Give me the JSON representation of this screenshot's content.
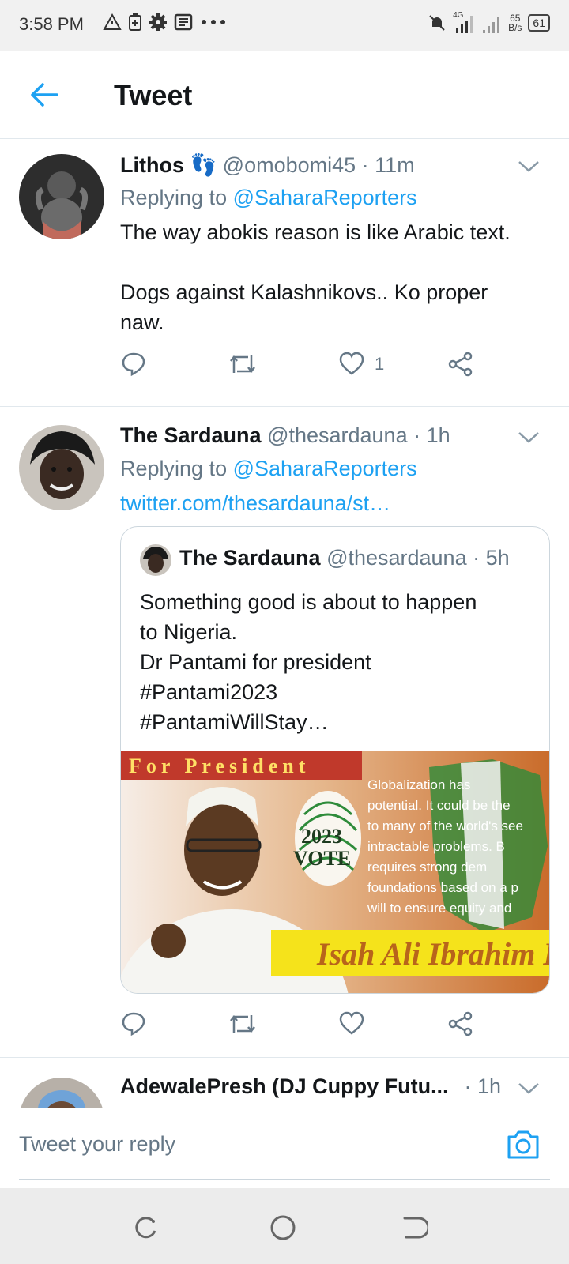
{
  "status_bar": {
    "time": "3:58 PM",
    "network": "4G",
    "speed_value": "65",
    "speed_unit": "B/s",
    "battery": "61"
  },
  "header": {
    "title": "Tweet"
  },
  "tweets": [
    {
      "name": "Lithos",
      "emoji": "👣",
      "handle": "@omobomi45",
      "time": "· 11m",
      "replying_prefix": "Replying to",
      "replying_to": "@SaharaReporters",
      "body_lines": [
        "The way abokis reason is like Arabic text.",
        "",
        "Dogs against Kalashnikovs.. Ko proper",
        "naw."
      ],
      "like_count": "1"
    },
    {
      "name": "The Sardauna",
      "handle": "@thesardauna",
      "time": "· 1h",
      "replying_prefix": "Replying to",
      "replying_to": "@SaharaReporters",
      "link": "twitter.com/thesardauna/st…",
      "quote": {
        "name": "The Sardauna",
        "handle": "@thesardauna",
        "time": "· 5h",
        "body_lines": [
          "Something good is about to happen",
          "to Nigeria.",
          "Dr Pantami for president",
          "#Pantami2023",
          "#PantamiWillStay…"
        ],
        "image": {
          "banner": "For President",
          "vote_year": "2023",
          "vote_word": "VOTE",
          "text_lines": [
            "Globalization        has",
            "potential. It could be the",
            "to many of the world's see",
            "intractable  problems.  B",
            "requires      strong      dem",
            "foundations based on a p",
            "will to ensure equity and"
          ],
          "name_banner": "Isah Ali Ibrahim I"
        }
      }
    },
    {
      "name": "AdewalePresh (DJ Cuppy Futu...",
      "time": "· 1h"
    }
  ],
  "reply_bar": {
    "placeholder": "Tweet your reply"
  },
  "colors": {
    "accent": "#1da1f2",
    "muted": "#657786",
    "text": "#14171a",
    "divider": "#e1e8ed"
  }
}
